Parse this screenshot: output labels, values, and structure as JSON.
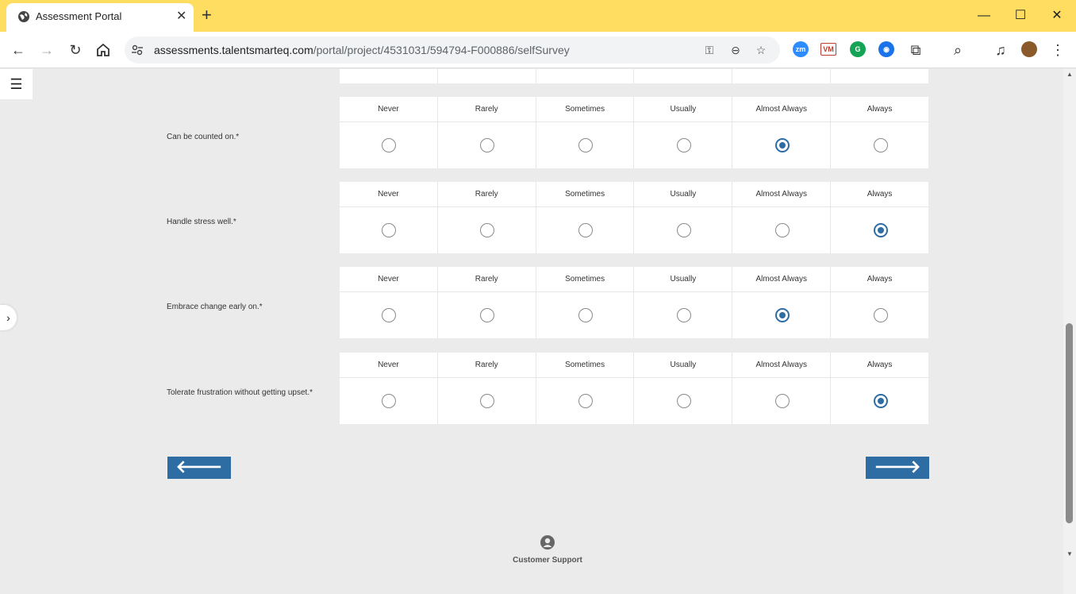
{
  "browser": {
    "tab_title": "Assessment Portal",
    "url_host": "assessments.talentsmarteq.com",
    "url_path": "/portal/project/4531031/594794-F000886/selfSurvey",
    "extensions": [
      {
        "name": "zoom-extension-icon",
        "label": "zm",
        "color": "#2d8cff"
      },
      {
        "name": "vm-extension-icon",
        "label": "VM",
        "color": "#c0392b"
      },
      {
        "name": "grammarly-extension-icon",
        "label": "G",
        "color": "#15a356"
      },
      {
        "name": "circle-extension-icon",
        "label": "◉",
        "color": "#1a73e8"
      }
    ]
  },
  "survey": {
    "options": [
      "Never",
      "Rarely",
      "Sometimes",
      "Usually",
      "Almost Always",
      "Always"
    ],
    "questions": [
      {
        "label": "Can be counted on.*",
        "selected": 4
      },
      {
        "label": "Handle stress well.*",
        "selected": 5
      },
      {
        "label": "Embrace change early on.*",
        "selected": 4
      },
      {
        "label": "Tolerate frustration without getting upset.*",
        "selected": 5
      }
    ]
  },
  "nav": {
    "prev": "🡐",
    "next": "🡒"
  },
  "footer": {
    "support_label": "Customer Support"
  },
  "colors": {
    "accent": "#2e6da4",
    "titlebar": "#fedd60"
  }
}
